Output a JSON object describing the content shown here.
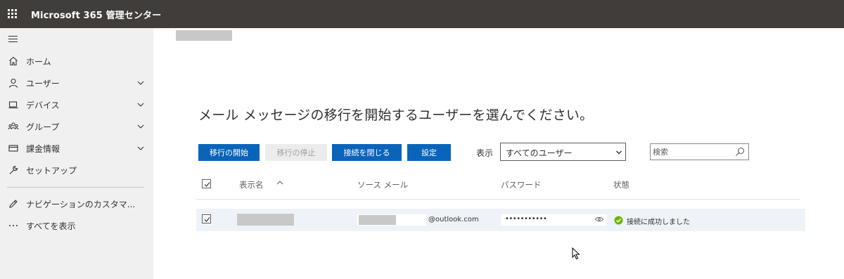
{
  "header": {
    "app_title": "Microsoft 365 管理センター",
    "app_launcher_icon": "waffle-icon"
  },
  "sidebar": {
    "menu_icon": "hamburger-icon",
    "items": [
      {
        "label": "ホーム",
        "icon": "home-icon",
        "expandable": false
      },
      {
        "label": "ユーザー",
        "icon": "person-icon",
        "expandable": true
      },
      {
        "label": "デバイス",
        "icon": "device-icon",
        "expandable": true
      },
      {
        "label": "グループ",
        "icon": "group-icon",
        "expandable": true
      },
      {
        "label": "課金情報",
        "icon": "card-icon",
        "expandable": true
      },
      {
        "label": "セットアップ",
        "icon": "wrench-icon",
        "expandable": false
      },
      {
        "label": "ナビゲーションのカスタマ...",
        "icon": "pencil-icon",
        "expandable": false
      },
      {
        "label": "すべてを表示",
        "icon": "ellipsis-icon",
        "expandable": false
      }
    ]
  },
  "main": {
    "heading": "メール メッセージの移行を開始するユーザーを選んでください。",
    "toolbar": {
      "start_migration": "移行の開始",
      "stop_migration": "移行の停止",
      "close_connection": "接続を閉じる",
      "settings": "設定",
      "show_label": "表示",
      "show_select_value": "すべてのユーザー",
      "search_placeholder": "検索"
    },
    "table": {
      "columns": [
        "表示名",
        "ソース メール",
        "パスワード",
        "状態"
      ],
      "sorted_column": "表示名",
      "sort_direction": "ascending",
      "header_checkbox_checked": true,
      "rows": [
        {
          "checked": true,
          "display_name": "",
          "source_email_domain": "@outlook.com",
          "password": "•••••••••••",
          "status": "接続に成功しました",
          "status_color": "#6bb700"
        }
      ]
    }
  },
  "colors": {
    "topbar": "#403d3a",
    "sidebar": "#f0f0f0",
    "primary": "#0a64b9",
    "row_selected": "#eef3f9"
  }
}
